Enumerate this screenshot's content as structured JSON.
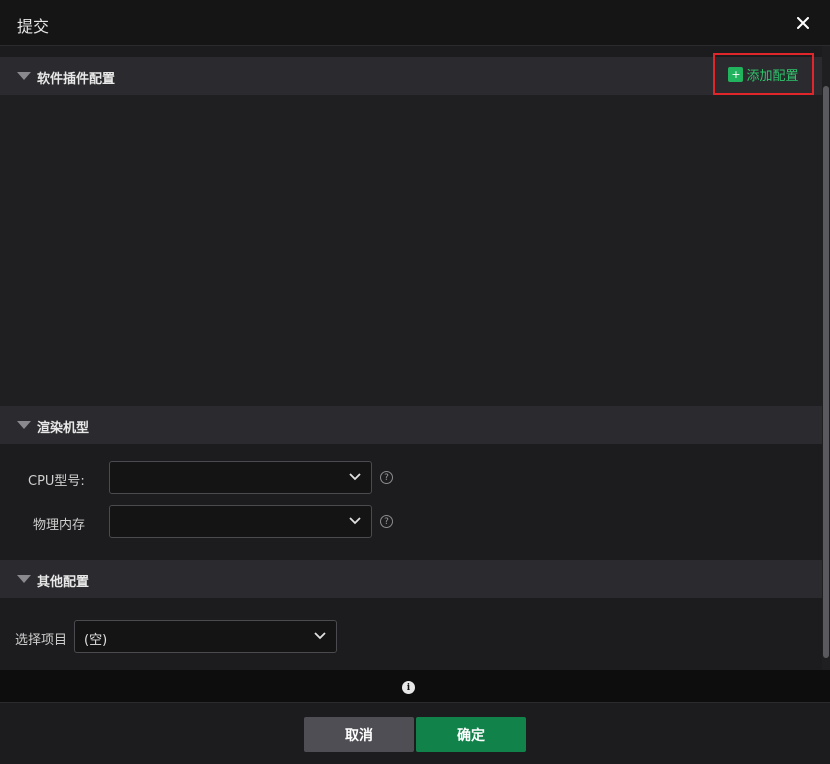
{
  "dialog": {
    "title": "提交",
    "close_glyph": "✕"
  },
  "sections": {
    "plugins": {
      "label": "软件插件配置",
      "add_label": "添加配置",
      "add_icon": "+"
    },
    "render": {
      "label": "渲染机型"
    },
    "other": {
      "label": "其他配置"
    }
  },
  "form": {
    "cpu": {
      "label": "CPU型号:",
      "value": ""
    },
    "memory": {
      "label": "物理内存",
      "value": ""
    },
    "project": {
      "label": "选择项目",
      "value": "(空)"
    },
    "help_glyph": "?"
  },
  "info": {
    "glyph": "i"
  },
  "footer": {
    "cancel_label": "取消",
    "ok_label": "确定"
  },
  "colors": {
    "accent_green": "#11824a",
    "highlight_red": "#e0262b"
  }
}
